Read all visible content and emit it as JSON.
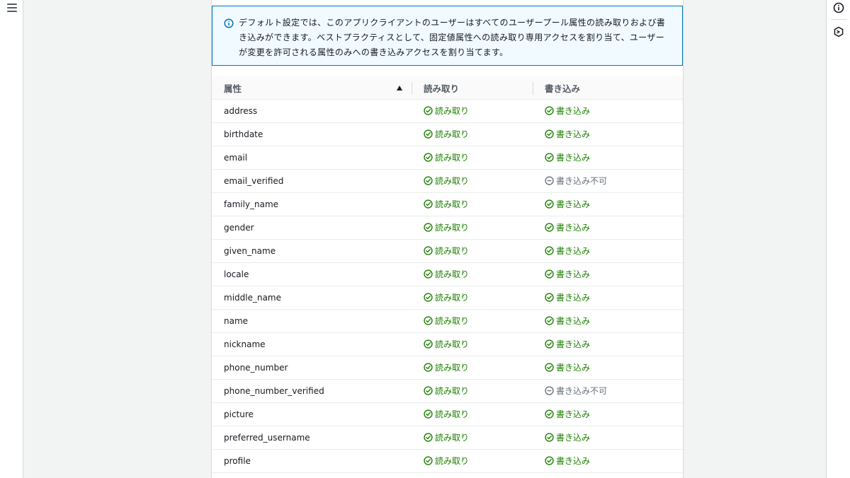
{
  "alert": {
    "text": "デフォルト設定では、このアプリクライアントのユーザーはすべてのユーザープール属性の読み取りおよび書き込みができます。ベストプラクティスとして、固定値属性への読み取り専用アクセスを割り当て、ユーザーが変更を許可される属性のみへの書き込みアクセスを割り当てます。"
  },
  "table": {
    "headers": {
      "attribute": "属性",
      "read": "読み取り",
      "write": "書き込み"
    },
    "rows": [
      {
        "attribute": "address",
        "read": "読み取り",
        "write": "書き込み",
        "write_status": "ok"
      },
      {
        "attribute": "birthdate",
        "read": "読み取り",
        "write": "書き込み",
        "write_status": "ok"
      },
      {
        "attribute": "email",
        "read": "読み取り",
        "write": "書き込み",
        "write_status": "ok"
      },
      {
        "attribute": "email_verified",
        "read": "読み取り",
        "write": "書き込み不可",
        "write_status": "na"
      },
      {
        "attribute": "family_name",
        "read": "読み取り",
        "write": "書き込み",
        "write_status": "ok"
      },
      {
        "attribute": "gender",
        "read": "読み取り",
        "write": "書き込み",
        "write_status": "ok"
      },
      {
        "attribute": "given_name",
        "read": "読み取り",
        "write": "書き込み",
        "write_status": "ok"
      },
      {
        "attribute": "locale",
        "read": "読み取り",
        "write": "書き込み",
        "write_status": "ok"
      },
      {
        "attribute": "middle_name",
        "read": "読み取り",
        "write": "書き込み",
        "write_status": "ok"
      },
      {
        "attribute": "name",
        "read": "読み取り",
        "write": "書き込み",
        "write_status": "ok"
      },
      {
        "attribute": "nickname",
        "read": "読み取り",
        "write": "書き込み",
        "write_status": "ok"
      },
      {
        "attribute": "phone_number",
        "read": "読み取り",
        "write": "書き込み",
        "write_status": "ok"
      },
      {
        "attribute": "phone_number_verified",
        "read": "読み取り",
        "write": "書き込み不可",
        "write_status": "na"
      },
      {
        "attribute": "picture",
        "read": "読み取り",
        "write": "書き込み",
        "write_status": "ok"
      },
      {
        "attribute": "preferred_username",
        "read": "読み取り",
        "write": "書き込み",
        "write_status": "ok"
      },
      {
        "attribute": "profile",
        "read": "読み取り",
        "write": "書き込み",
        "write_status": "ok"
      }
    ]
  },
  "icons": {
    "nav": "hamburger-menu-icon",
    "rail": [
      "info-circle-icon",
      "hexagon-settings-icon"
    ],
    "alert": "info-icon",
    "ok": "check-circle-icon",
    "na": "minus-circle-icon"
  },
  "colors": {
    "accent": "#0073bb",
    "success": "#1d8102",
    "disabled": "#687078",
    "alert_bg": "#f1faff"
  }
}
